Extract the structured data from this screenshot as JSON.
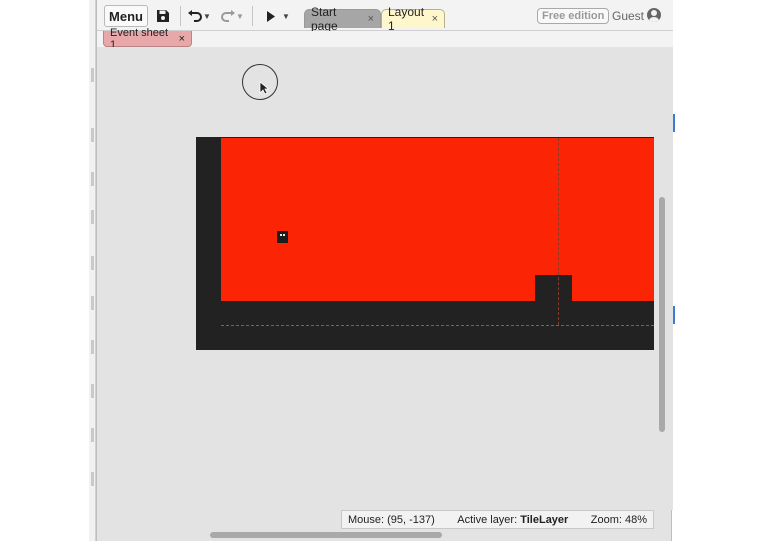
{
  "toolbar": {
    "menu_label": "Menu",
    "tabs": [
      {
        "label": "Start page",
        "close": "×"
      },
      {
        "label": "Layout 1",
        "close": "×"
      }
    ],
    "free_edition": "Free edition",
    "user_label": "Guest"
  },
  "subtabs": {
    "event_sheet": {
      "label": "Event sheet 1",
      "close": "×"
    }
  },
  "status": {
    "mouse_label": "Mouse: (95, -137)",
    "layer_label": "Active layer:",
    "layer_value": "TileLayer",
    "zoom_label": "Zoom: 48%"
  },
  "colors": {
    "background_red": "#fb2405",
    "tiles": "#222222",
    "tab_active": "#fff7cc",
    "event_tab": "#e8a8aa"
  },
  "icons": [
    "save-icon",
    "undo-icon",
    "redo-icon",
    "play-icon",
    "close-icon",
    "user-icon",
    "cursor-icon"
  ]
}
